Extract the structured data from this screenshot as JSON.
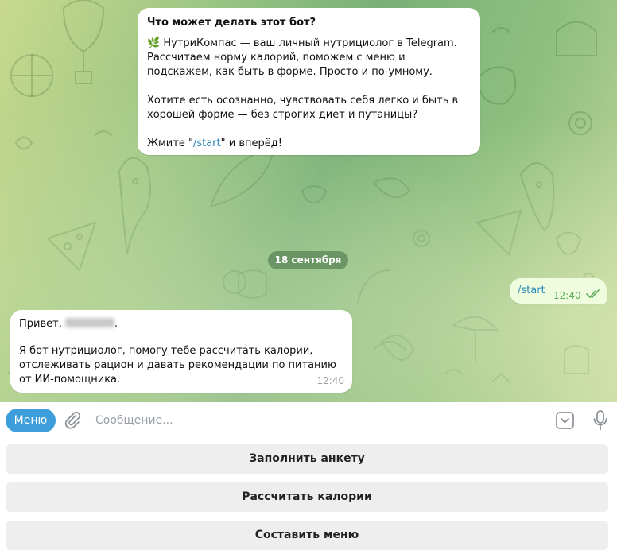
{
  "chat": {
    "bot_info": {
      "title": "Что может делать этот бот?",
      "intro_icon": "🌿",
      "intro": " НутриКомпас — ваш личный нутрициолог в Telegram. Рассчитаем норму калорий, поможем с меню и подскажем, как быть в форме. Просто и по-умному.",
      "paragraph2": "Хотите есть осознанно, чувствовать себя легко и быть в хорошей форме — без строгих диет и путаницы?",
      "cta_before": "Жмите \"",
      "cta_link": "/start",
      "cta_after": "\" и вперёд!"
    },
    "date_separator": "18 сентября",
    "outgoing": {
      "text": "/start",
      "time": "12:40",
      "status_icon": "double-check-icon"
    },
    "incoming": {
      "greeting": "Привет, ",
      "greeting_end": ".",
      "body": "Я бот нутрициолог, помогу тебе рассчитать калории, отслеживать рацион и давать рекомендации по питанию от ИИ-помощника.",
      "time": "12:40"
    }
  },
  "composer": {
    "menu_label": "Меню",
    "placeholder": "Сообщение...",
    "attach_icon": "paperclip-icon",
    "keyboard_icon": "keyboard-toggle-icon",
    "mic_icon": "microphone-icon"
  },
  "reply_keyboard": {
    "buttons": [
      "Заполнить анкету",
      "Рассчитать калории",
      "Составить меню"
    ]
  },
  "colors": {
    "accent": "#3e9ddb",
    "link": "#2a8ab8",
    "outgoing_bubble": "#effdde",
    "read_check": "#5fad5f"
  }
}
